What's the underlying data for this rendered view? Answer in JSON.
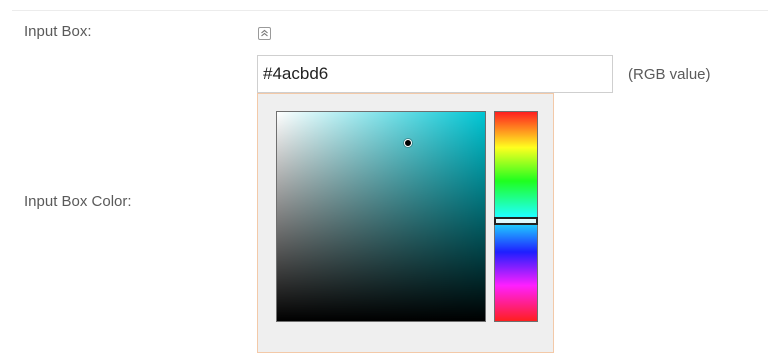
{
  "form": {
    "input_box_label": "Input Box:",
    "input_box_color_label": "Input Box Color:"
  },
  "collapse_button": {
    "icon": "double-chevron-up-icon"
  },
  "color_input": {
    "value": "#4acbd6",
    "hint": "(RGB value)"
  },
  "color_picker": {
    "selected_color": "#4acbd6",
    "base_hue_color": "#00c6d4",
    "hue_position_fraction": 0.52,
    "saturation_fraction": 0.63,
    "value_fraction": 0.85
  }
}
